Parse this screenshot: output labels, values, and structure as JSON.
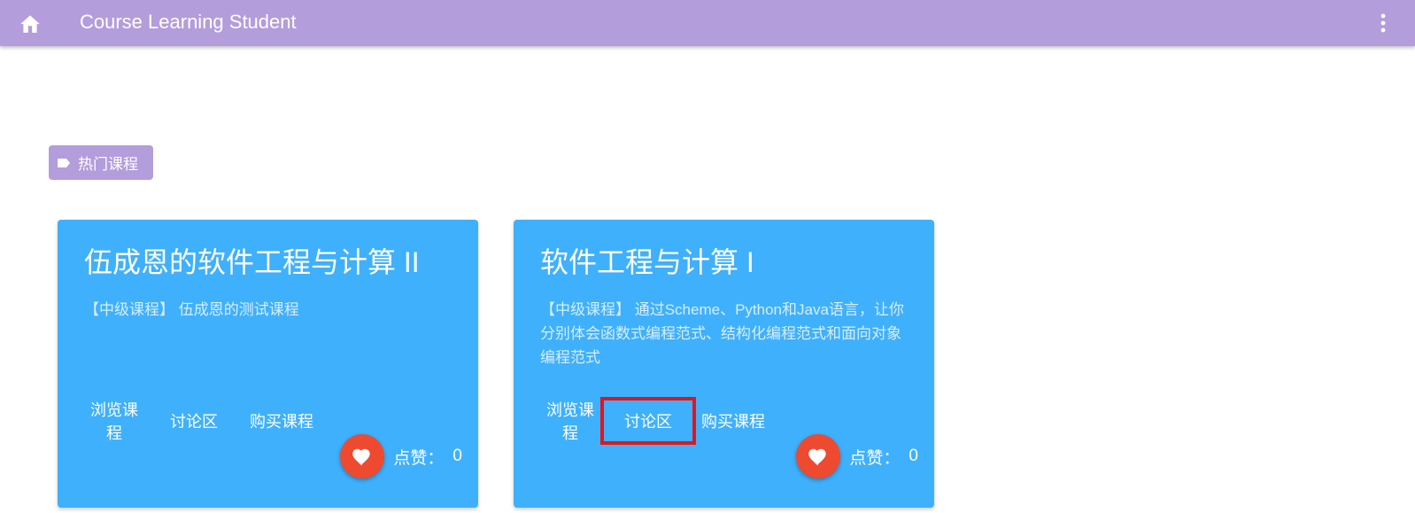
{
  "app": {
    "title": "Course Learning Student",
    "home_icon": "home-icon",
    "menu_icon": "more-vert-icon",
    "bar_color": "#b39ddb"
  },
  "section": {
    "tag_label": "热门课程",
    "tag_icon": "label-icon"
  },
  "courses": [
    {
      "title": "伍成恩的软件工程与计算 II",
      "description": "【中级课程】 伍成恩的测试课程",
      "actions": [
        "浏览课程",
        "讨论区",
        "购买课程"
      ],
      "like_label": "点赞：",
      "likes": "0"
    },
    {
      "title": "软件工程与计算 I",
      "description": "【中级课程】 通过Scheme、Python和Java语言，让你分别体会函数式编程范式、结构化编程范式和面向对象编程范式",
      "actions": [
        "浏览课程",
        "讨论区",
        "购买课程"
      ],
      "like_label": "点赞：",
      "likes": "0"
    }
  ],
  "colors": {
    "card": "#3fb0fc",
    "like_button": "#ee4a30",
    "highlight": "#e0161f"
  }
}
